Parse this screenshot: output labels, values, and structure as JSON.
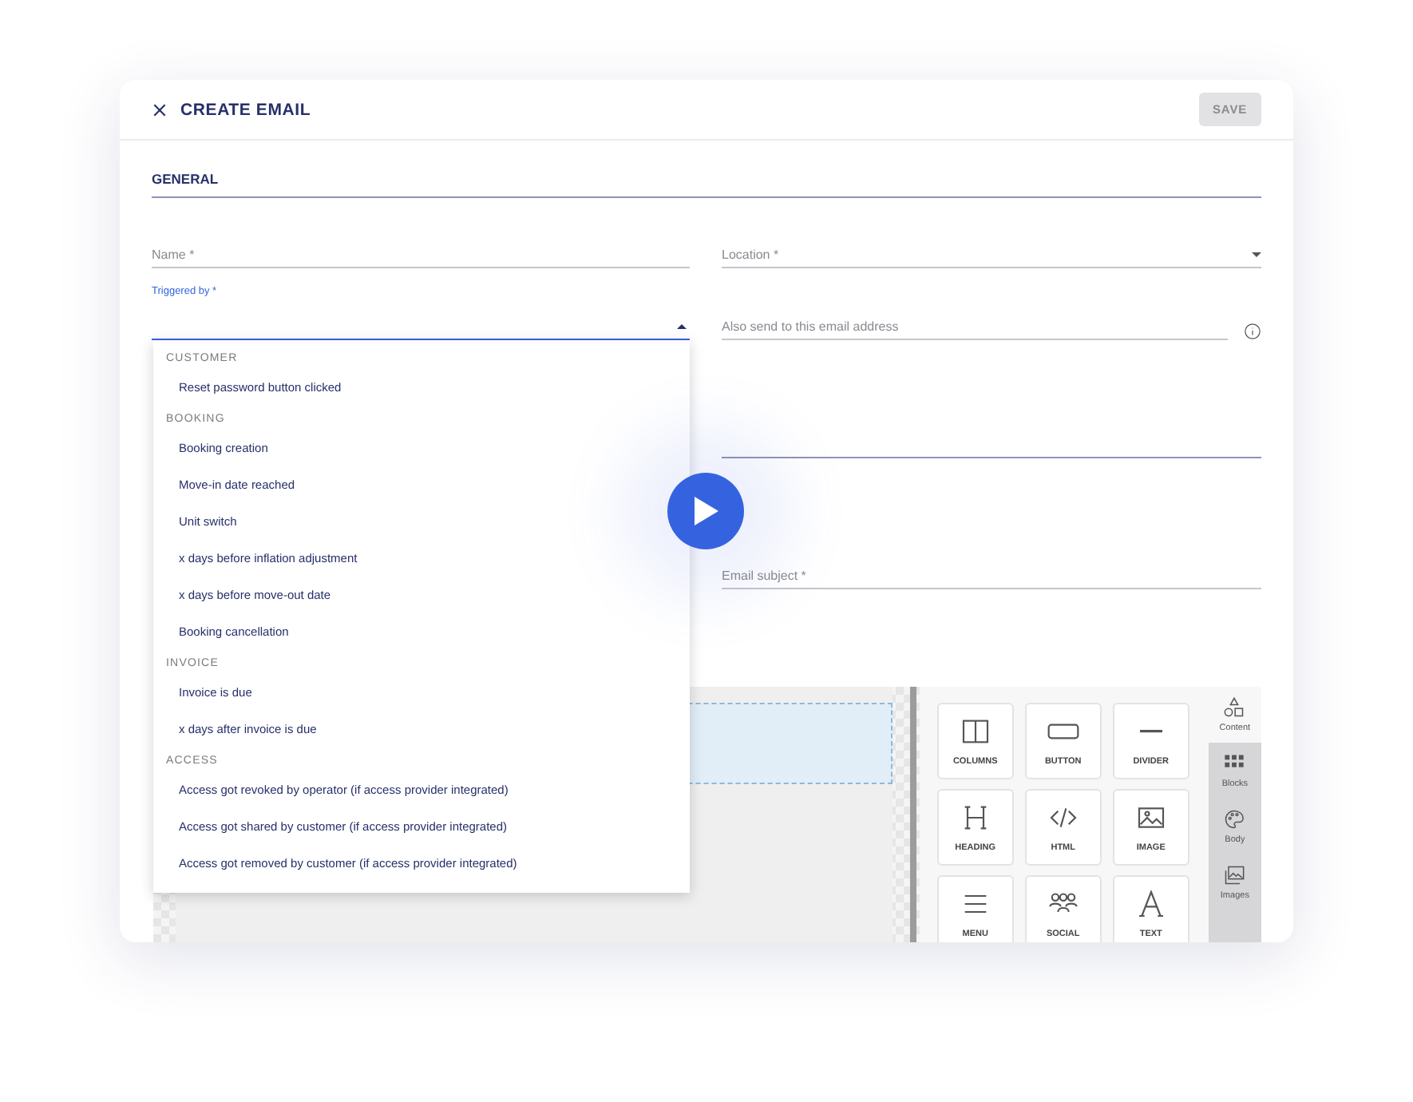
{
  "window": {
    "title": "CREATE EMAIL",
    "save_button": {
      "label": "SAVE",
      "disabled": true
    }
  },
  "section": {
    "title": "GENERAL"
  },
  "name_field": {
    "placeholder": "Name *"
  },
  "location_field": {
    "placeholder": "Location *"
  },
  "trigger_field": {
    "label": "Triggered by *",
    "expanded": true
  },
  "cc_field": {
    "placeholder": "Also send to this email address"
  },
  "subject_field": {
    "placeholder": "Email subject *"
  },
  "trigger_options": [
    {
      "group": "CUSTOMER",
      "items": [
        "Reset password button clicked"
      ]
    },
    {
      "group": "BOOKING",
      "items": [
        "Booking creation",
        "Move-in date reached",
        "Unit switch",
        "x days before inflation adjustment",
        "x days before move-out date",
        "Booking cancellation"
      ]
    },
    {
      "group": "INVOICE",
      "items": [
        "Invoice is due",
        "x days after invoice is due"
      ]
    },
    {
      "group": "ACCESS",
      "items": [
        "Access got revoked by operator (if access provider integrated)",
        "Access got shared by customer (if access provider integrated)",
        "Access got removed by customer (if access provider integrated)"
      ]
    }
  ],
  "tools": [
    {
      "kind": "columns",
      "label": "COLUMNS"
    },
    {
      "kind": "button",
      "label": "BUTTON"
    },
    {
      "kind": "divider",
      "label": "DIVIDER"
    },
    {
      "kind": "heading",
      "label": "HEADING"
    },
    {
      "kind": "html",
      "label": "HTML"
    },
    {
      "kind": "image",
      "label": "IMAGE"
    },
    {
      "kind": "menu",
      "label": "MENU"
    },
    {
      "kind": "social",
      "label": "SOCIAL"
    },
    {
      "kind": "text",
      "label": "TEXT"
    }
  ],
  "side_tabs": [
    {
      "kind": "content",
      "label": "Content",
      "selected": true
    },
    {
      "kind": "blocks",
      "label": "Blocks",
      "selected": false
    },
    {
      "kind": "body",
      "label": "Body",
      "selected": false
    },
    {
      "kind": "images",
      "label": "Images",
      "selected": false
    }
  ]
}
